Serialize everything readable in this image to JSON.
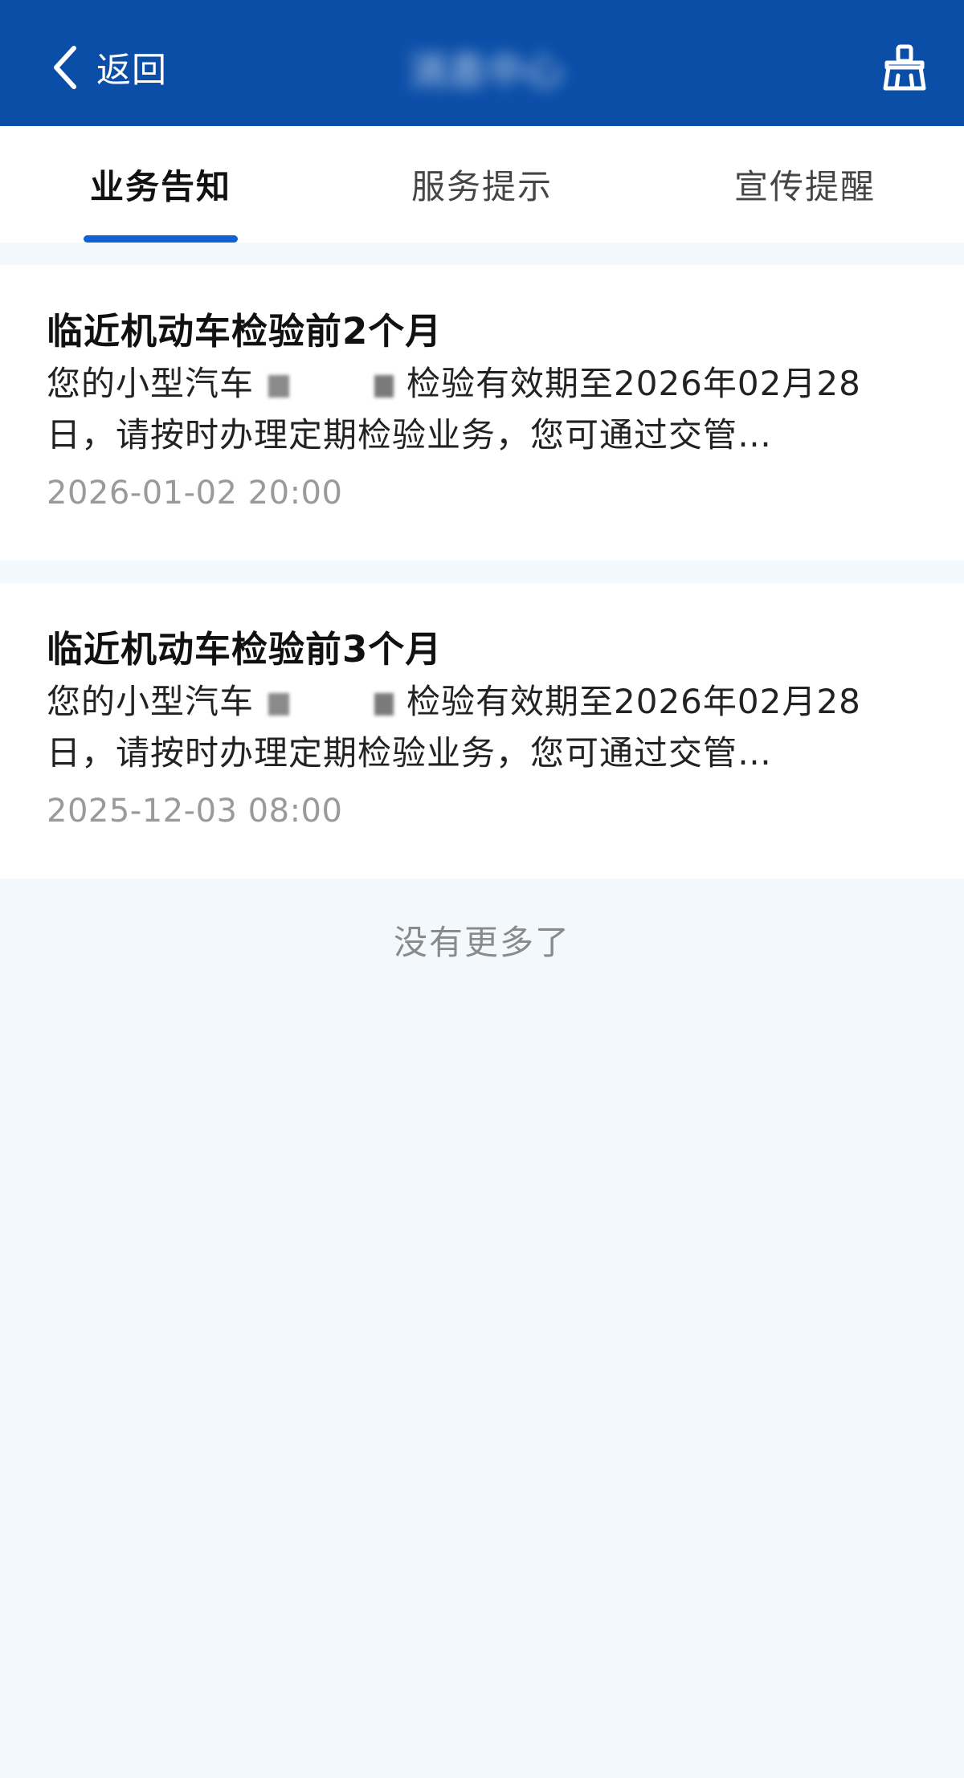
{
  "header": {
    "back_label": "返回",
    "title": "消息中心",
    "back_icon": "chevron-left-icon",
    "clean_icon": "broom-icon",
    "background_color": "#0b4ea8"
  },
  "tabs": [
    {
      "label": "业务告知",
      "active": true
    },
    {
      "label": "服务提示",
      "active": false
    },
    {
      "label": "宣传提醒",
      "active": false
    }
  ],
  "accent_color": "#1261d6",
  "messages": [
    {
      "title": "临近机动车检验前2个月",
      "body_prefix": "您的小型汽车",
      "body_suffix": "检验有效期至2026年02月28",
      "body_line2": "日，请按时办理定期检验业务，您可通过交管…",
      "time": "2026-01-02 20:00"
    },
    {
      "title": "临近机动车检验前3个月",
      "body_prefix": "您的小型汽车",
      "body_suffix": "检验有效期至2026年02月28",
      "body_line2": "日，请按时办理定期检验业务，您可通过交管…",
      "time": "2025-12-03 08:00"
    }
  ],
  "end_text": "没有更多了"
}
